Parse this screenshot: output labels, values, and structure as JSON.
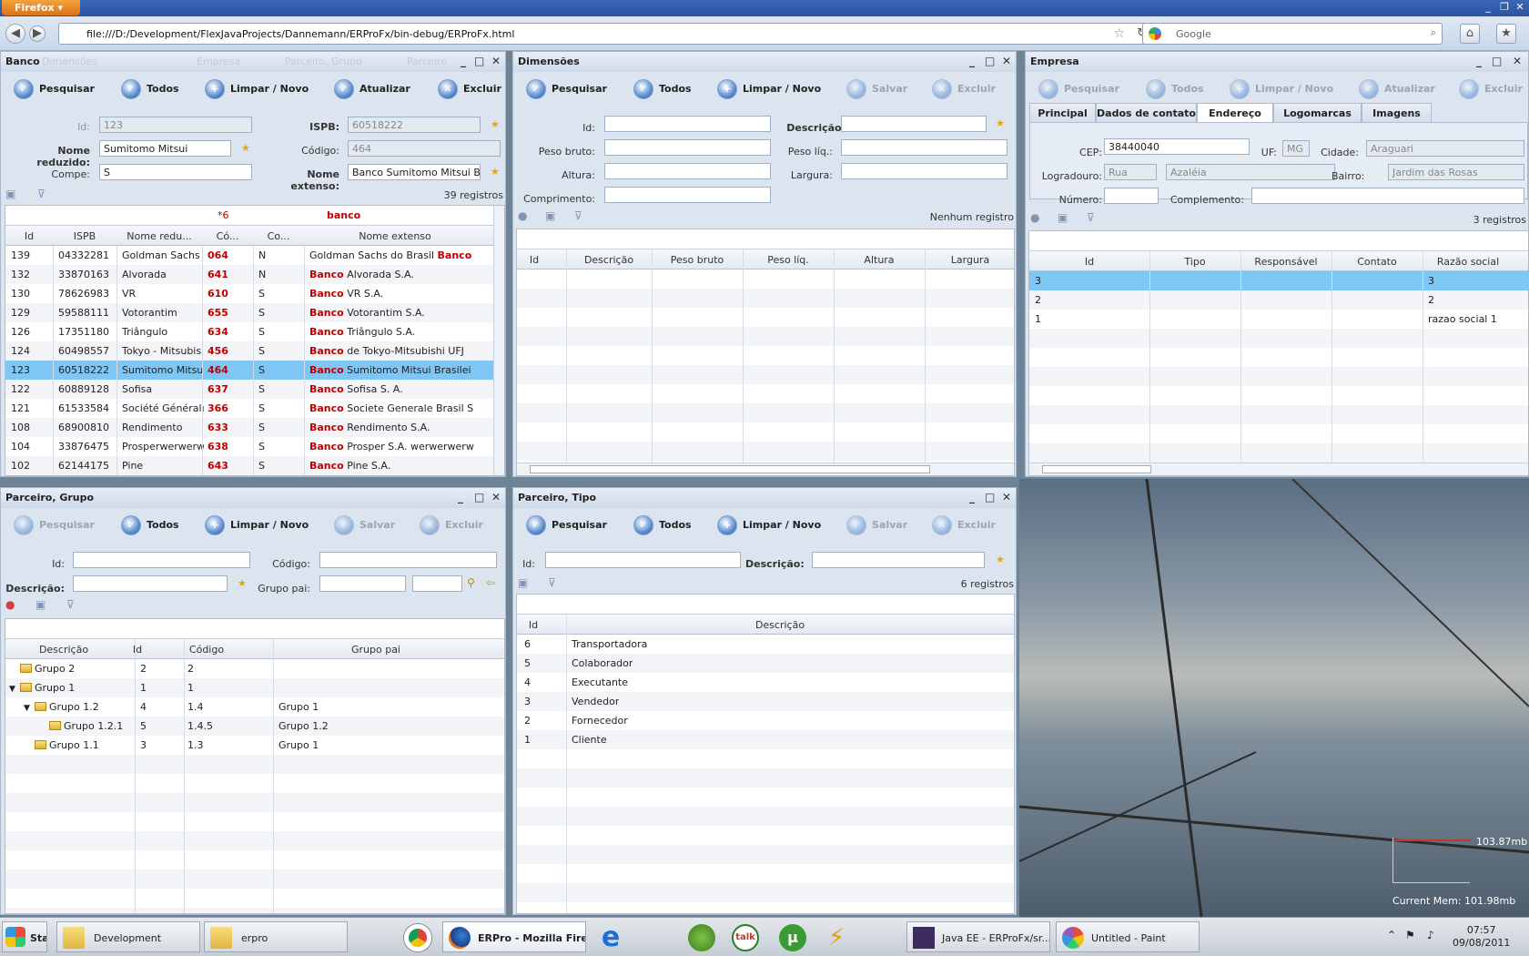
{
  "browser": {
    "menu_label": "Firefox",
    "url": "file:///D:/Development/FlexJavaProjects/Dannemann/ERProFx/bin-debug/ERProFx.html",
    "search_placeholder": "Google"
  },
  "banco": {
    "title": "Banco",
    "ghost_tabs": [
      "Dimensões",
      "Empresa",
      "Parceiro, Grupo",
      "Parceiro"
    ],
    "buttons": [
      "Pesquisar",
      "Todos",
      "Limpar / Novo",
      "Atualizar",
      "Excluir"
    ],
    "form": {
      "id_label": "Id:",
      "id_value": "123",
      "isbp_label": "ISPB:",
      "isbp_value": "60518222",
      "nome_reduzido_label": "Nome reduzido:",
      "nome_reduzido_value": "Sumitomo Mitsui",
      "codigo_label": "Código:",
      "codigo_value": "464",
      "compe_label": "Compe:",
      "compe_value": "S",
      "nome_extenso_label": "Nome extenso:",
      "nome_extenso_value": "Banco Sumitomo Mitsui B"
    },
    "count": "39 registros",
    "filters": {
      "codigo": "*6",
      "nome_extenso": "banco"
    },
    "columns": [
      "Id",
      "ISPB",
      "Nome redu...",
      "Có...",
      "Co...",
      "Nome extenso"
    ],
    "rows": [
      {
        "id": "139",
        "ispb": "04332281",
        "nome": "Goldman Sachs",
        "cod": "064",
        "compe": "N",
        "ext_pre": "Goldman Sachs do Brasil ",
        "ext_hl": "Banco",
        "ext_post": ""
      },
      {
        "id": "132",
        "ispb": "33870163",
        "nome": "Alvorada",
        "cod": "641",
        "compe": "N",
        "ext_pre": "",
        "ext_hl": "Banco",
        "ext_post": " Alvorada S.A."
      },
      {
        "id": "130",
        "ispb": "78626983",
        "nome": "VR",
        "cod": "610",
        "compe": "S",
        "ext_pre": "",
        "ext_hl": "Banco",
        "ext_post": " VR S.A."
      },
      {
        "id": "129",
        "ispb": "59588111",
        "nome": "Votorantim",
        "cod": "655",
        "compe": "S",
        "ext_pre": "",
        "ext_hl": "Banco",
        "ext_post": " Votorantim S.A."
      },
      {
        "id": "126",
        "ispb": "17351180",
        "nome": "Triângulo",
        "cod": "634",
        "compe": "S",
        "ext_pre": "",
        "ext_hl": "Banco",
        "ext_post": " Triângulo S.A."
      },
      {
        "id": "124",
        "ispb": "60498557",
        "nome": "Tokyo - Mitsubis",
        "cod": "456",
        "compe": "S",
        "ext_pre": "",
        "ext_hl": "Banco",
        "ext_post": " de Tokyo-Mitsubishi UFJ"
      },
      {
        "id": "123",
        "ispb": "60518222",
        "nome": "Sumitomo Mitsu",
        "cod": "464",
        "compe": "S",
        "ext_pre": "",
        "ext_hl": "Banco",
        "ext_post": " Sumitomo Mitsui Brasilei"
      },
      {
        "id": "122",
        "ispb": "60889128",
        "nome": "Sofisa",
        "cod": "637",
        "compe": "S",
        "ext_pre": "",
        "ext_hl": "Banco",
        "ext_post": " Sofisa S. A."
      },
      {
        "id": "121",
        "ispb": "61533584",
        "nome": "Société Générale",
        "cod": "366",
        "compe": "S",
        "ext_pre": "",
        "ext_hl": "Banco",
        "ext_post": " Societe Generale Brasil S"
      },
      {
        "id": "108",
        "ispb": "68900810",
        "nome": "Rendimento",
        "cod": "633",
        "compe": "S",
        "ext_pre": "",
        "ext_hl": "Banco",
        "ext_post": " Rendimento S.A."
      },
      {
        "id": "104",
        "ispb": "33876475",
        "nome": "Prosperwerwerwe",
        "cod": "638",
        "compe": "S",
        "ext_pre": "",
        "ext_hl": "Banco",
        "ext_post": " Prosper S.A. werwerwerw"
      },
      {
        "id": "102",
        "ispb": "62144175",
        "nome": "Pine",
        "cod": "643",
        "compe": "S",
        "ext_pre": "",
        "ext_hl": "Banco",
        "ext_post": " Pine S.A."
      }
    ]
  },
  "dimensoes": {
    "title": "Dimensões",
    "buttons": [
      "Pesquisar",
      "Todos",
      "Limpar / Novo",
      "Salvar",
      "Excluir"
    ],
    "form": {
      "id_label": "Id:",
      "descricao_label": "Descrição:",
      "peso_bruto_label": "Peso bruto:",
      "peso_liq_label": "Peso líq.:",
      "altura_label": "Altura:",
      "largura_label": "Largura:",
      "comprimento_label": "Comprimento:"
    },
    "count": "Nenhum registro",
    "columns": [
      "Id",
      "Descrição",
      "Peso bruto",
      "Peso líq.",
      "Altura",
      "Largura"
    ]
  },
  "empresa": {
    "title": "Empresa",
    "buttons": [
      "Pesquisar",
      "Todos",
      "Limpar / Novo",
      "Atualizar",
      "Excluir"
    ],
    "tabs": [
      "Principal",
      "Dados de contato",
      "Endereço",
      "Logomarcas",
      "Imagens"
    ],
    "form": {
      "cep_label": "CEP:",
      "cep_value": "38440040",
      "uf_label": "UF:",
      "uf_value": "MG",
      "cidade_label": "Cidade:",
      "cidade_value": "Araguari",
      "logradouro_label": "Logradouro:",
      "logradouro_tipo": "Rua",
      "logradouro_value": "Azaléia",
      "bairro_label": "Bairro:",
      "bairro_value": "Jardim das Rosas",
      "numero_label": "Número:",
      "complemento_label": "Complemento:"
    },
    "count": "3 registros",
    "columns": [
      "Id",
      "Tipo",
      "Responsável",
      "Contato",
      "Razão social"
    ],
    "rows": [
      {
        "id": "3",
        "razao": "3"
      },
      {
        "id": "2",
        "razao": "2"
      },
      {
        "id": "1",
        "razao": "razao social 1"
      }
    ]
  },
  "grupo": {
    "title": "Parceiro, Grupo",
    "buttons": [
      "Pesquisar",
      "Todos",
      "Limpar / Novo",
      "Salvar",
      "Excluir"
    ],
    "form": {
      "id_label": "Id:",
      "codigo_label": "Código:",
      "descricao_label": "Descrição:",
      "grupo_pai_label": "Grupo pai:"
    },
    "columns": [
      "Descrição",
      "Id",
      "Código",
      "Grupo pai"
    ],
    "rows": [
      {
        "desc": "Grupo 2",
        "id": "2",
        "cod": "2",
        "pai": "",
        "level": 0,
        "toggle": ""
      },
      {
        "desc": "Grupo 1",
        "id": "1",
        "cod": "1",
        "pai": "",
        "level": 0,
        "toggle": "▼"
      },
      {
        "desc": "Grupo 1.2",
        "id": "4",
        "cod": "1.4",
        "pai": "Grupo 1",
        "level": 1,
        "toggle": "▼"
      },
      {
        "desc": "Grupo 1.2.1",
        "id": "5",
        "cod": "1.4.5",
        "pai": "Grupo 1.2",
        "level": 2,
        "toggle": ""
      },
      {
        "desc": "Grupo 1.1",
        "id": "3",
        "cod": "1.3",
        "pai": "Grupo 1",
        "level": 1,
        "toggle": ""
      }
    ]
  },
  "tipo": {
    "title": "Parceiro, Tipo",
    "buttons": [
      "Pesquisar",
      "Todos",
      "Limpar / Novo",
      "Salvar",
      "Excluir"
    ],
    "form": {
      "id_label": "Id:",
      "descricao_label": "Descrição:"
    },
    "count": "6 registros",
    "columns": [
      "Id",
      "Descrição"
    ],
    "rows": [
      {
        "id": "6",
        "desc": "Transportadora"
      },
      {
        "id": "5",
        "desc": "Colaborador"
      },
      {
        "id": "4",
        "desc": "Executante"
      },
      {
        "id": "3",
        "desc": "Vendedor"
      },
      {
        "id": "2",
        "desc": "Fornecedor"
      },
      {
        "id": "1",
        "desc": "Cliente"
      }
    ]
  },
  "memory": {
    "peak": "103.87mb",
    "current": "Current Mem: 101.98mb"
  },
  "taskbar": {
    "start": "Start",
    "items": [
      "Development",
      "erpro",
      "ERPro - Mozilla Fire...",
      "Java EE - ERProFx/sr...",
      "Untitled - Paint"
    ],
    "time": "07:57",
    "date": "09/08/2011"
  }
}
